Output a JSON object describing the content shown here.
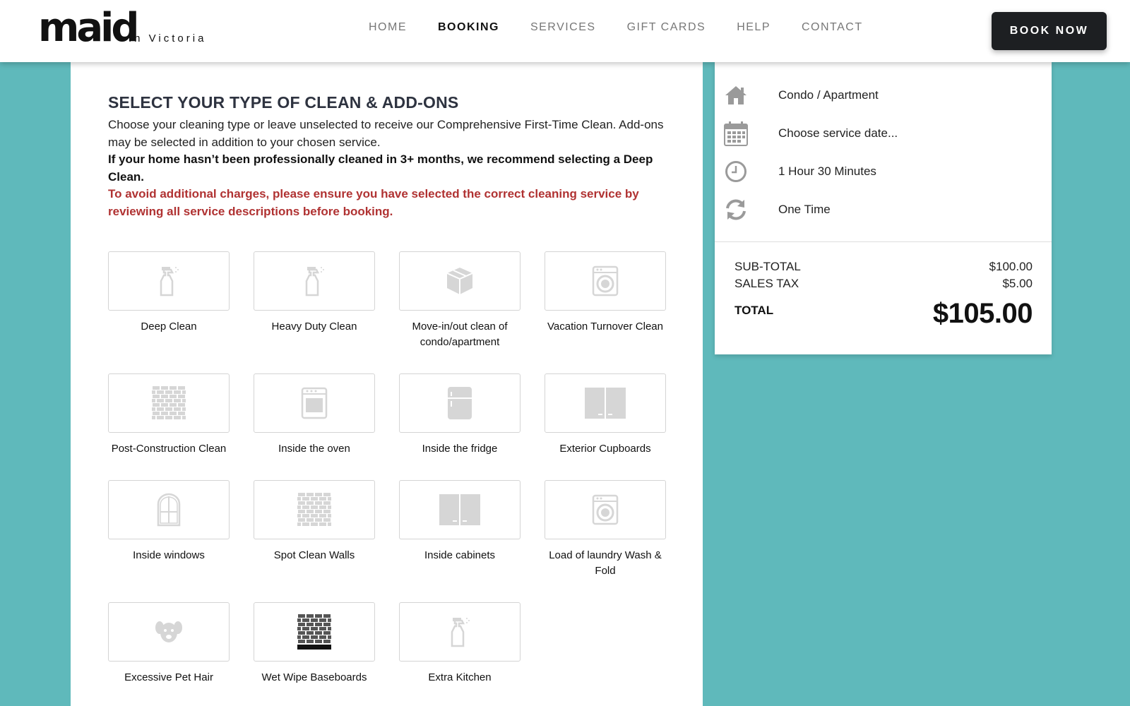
{
  "header": {
    "logo_main": "maid",
    "logo_sub": "In Victoria",
    "nav": [
      "HOME",
      "BOOKING",
      "SERVICES",
      "GIFT CARDS",
      "HELP",
      "CONTACT"
    ],
    "active_nav": "BOOKING",
    "book_button": "BOOK NOW"
  },
  "main": {
    "title": "SELECT YOUR TYPE OF CLEAN & ADD-ONS",
    "desc_1": "Choose your cleaning type or leave unselected to receive our Comprehensive First-Time Clean. Add-ons may be selected in addition to your chosen service.",
    "desc_2": "If your home hasn’t been professionally cleaned in 3+ months, we recommend selecting a Deep Clean.",
    "desc_3": "To avoid additional charges, please ensure you have selected the correct cleaning service by reviewing all service descriptions before booking.",
    "services": [
      {
        "label": "Deep Clean",
        "icon": "spray-bottle-icon"
      },
      {
        "label": "Heavy Duty Clean",
        "icon": "spray-bottle-icon"
      },
      {
        "label": "Move-in/out clean of condo/apartment",
        "icon": "box-icon"
      },
      {
        "label": "Vacation Turnover Clean",
        "icon": "washer-icon"
      },
      {
        "label": "Post-Construction Clean",
        "icon": "brick-wall-icon"
      },
      {
        "label": "Inside the oven",
        "icon": "oven-icon"
      },
      {
        "label": "Inside the fridge",
        "icon": "fridge-icon"
      },
      {
        "label": "Exterior Cupboards",
        "icon": "cupboard-icon"
      },
      {
        "label": "Inside windows",
        "icon": "window-icon"
      },
      {
        "label": "Spot Clean Walls",
        "icon": "brick-wall-icon"
      },
      {
        "label": "Inside cabinets",
        "icon": "cupboard-icon"
      },
      {
        "label": "Load of laundry Wash & Fold",
        "icon": "washer-icon"
      },
      {
        "label": "Excessive Pet Hair",
        "icon": "dog-icon"
      },
      {
        "label": "Wet Wipe Baseboards",
        "icon": "baseboard-icon"
      },
      {
        "label": "Extra Kitchen",
        "icon": "spray-bottle-icon"
      }
    ]
  },
  "summary": {
    "property": "Condo / Apartment",
    "date": "Choose service date...",
    "duration": "1 Hour 30 Minutes",
    "frequency": "One Time",
    "subtotal_label": "SUB-TOTAL",
    "subtotal": "$100.00",
    "tax_label": "SALES TAX",
    "tax": "$5.00",
    "total_label": "TOTAL",
    "total": "$105.00"
  },
  "colors": {
    "background": "#5fb9bb",
    "warning": "#b03232",
    "button": "#1d1f22",
    "icon_grey": "#d6d6d6",
    "summary_icon": "#9a9a9a"
  }
}
